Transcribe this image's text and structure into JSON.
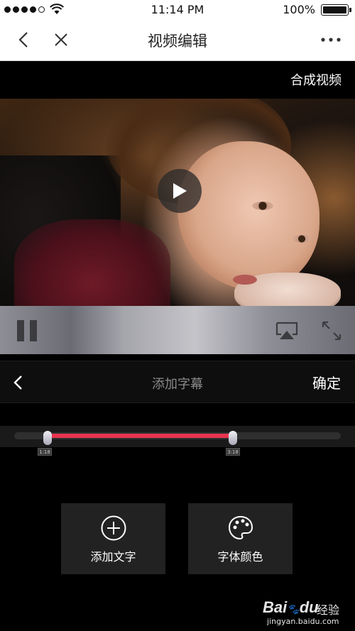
{
  "status_bar": {
    "time": "11:14 PM",
    "battery_text": "100%",
    "signal_dots_filled": 4,
    "signal_dots_total": 5
  },
  "nav": {
    "title": "视频编辑",
    "back_icon": "chevron-left-icon",
    "close_icon": "close-icon",
    "more_icon": "more-dots-icon"
  },
  "header": {
    "compose_label": "合成视频"
  },
  "video": {
    "play_icon": "play-icon",
    "pause_icon": "pause-icon",
    "airplay_icon": "airplay-icon",
    "fullscreen_icon": "fullscreen-icon"
  },
  "subtitle_panel": {
    "title": "添加字幕",
    "confirm_label": "确定",
    "back_icon": "chevron-left-icon"
  },
  "timeline": {
    "start_label": "1:18",
    "end_label": "3:18",
    "accent_color": "#e8344f"
  },
  "actions": [
    {
      "label": "添加文字",
      "icon": "add-circle-icon"
    },
    {
      "label": "字体颜色",
      "icon": "palette-icon"
    }
  ],
  "watermark": {
    "brand": "Bai",
    "brand_suffix": "du",
    "cn": "经验",
    "url": "jingyan.baidu.com"
  }
}
